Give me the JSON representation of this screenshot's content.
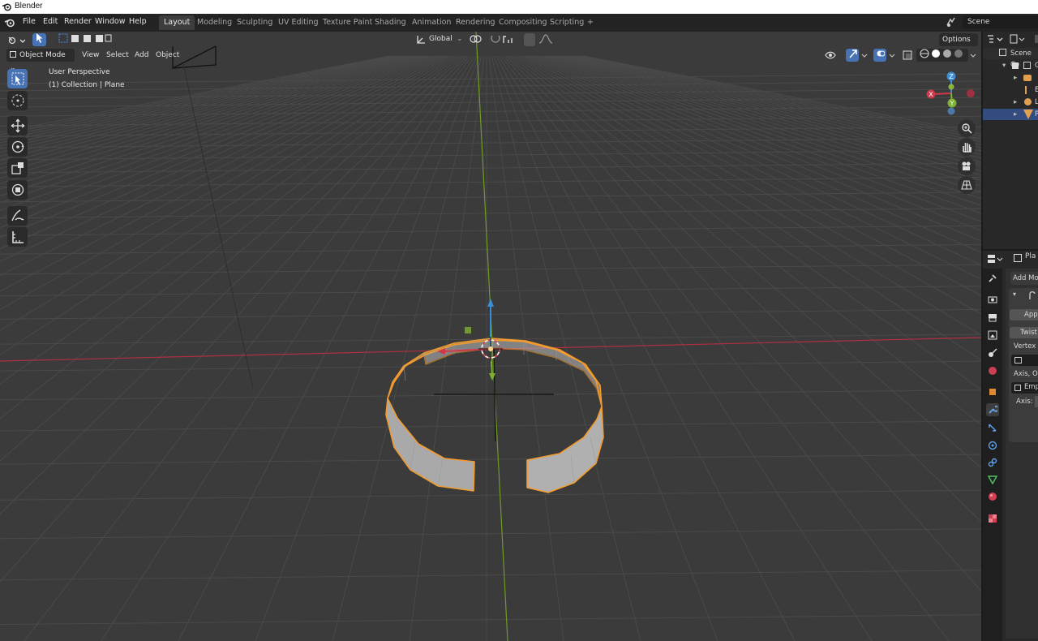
{
  "window": {
    "title": "Blender"
  },
  "menubar": {
    "items": [
      "File",
      "Edit",
      "Render",
      "Window",
      "Help"
    ]
  },
  "workspaces": {
    "tabs": [
      "Layout",
      "Modeling",
      "Sculpting",
      "UV Editing",
      "Texture Paint",
      "Shading",
      "Animation",
      "Rendering",
      "Compositing",
      "Scripting"
    ],
    "active": "Layout",
    "add": "+"
  },
  "scene": {
    "name": "Scene"
  },
  "viewport_header": {
    "transform_orientation": "Global",
    "options_label": "Options",
    "mode": "Object Mode",
    "menus": [
      "View",
      "Select",
      "Add",
      "Object"
    ]
  },
  "viewport_overlay": {
    "perspective": "User Perspective",
    "collection": "(1) Collection | Plane"
  },
  "gizmo_axes": {
    "x": "X",
    "y": "Y",
    "z": "Z"
  },
  "outliner": {
    "header": "Scene Co",
    "rows": [
      "C",
      "",
      "E",
      "L",
      "P"
    ]
  },
  "properties": {
    "object_name": "Pla",
    "add_modifier": "Add Modi",
    "apply_label": "App",
    "twist_label": "Twist",
    "vertex_group": "Vertex G",
    "axis_origin": "Axis, Or",
    "empty_label": "Emp",
    "axis_label": "Axis:"
  },
  "colors": {
    "accent_blue": "#4772b3",
    "selection_orange": "#f29b2e",
    "axis_red": "#d0384a",
    "axis_green": "#7fb232",
    "axis_blue": "#3b8ed6"
  }
}
